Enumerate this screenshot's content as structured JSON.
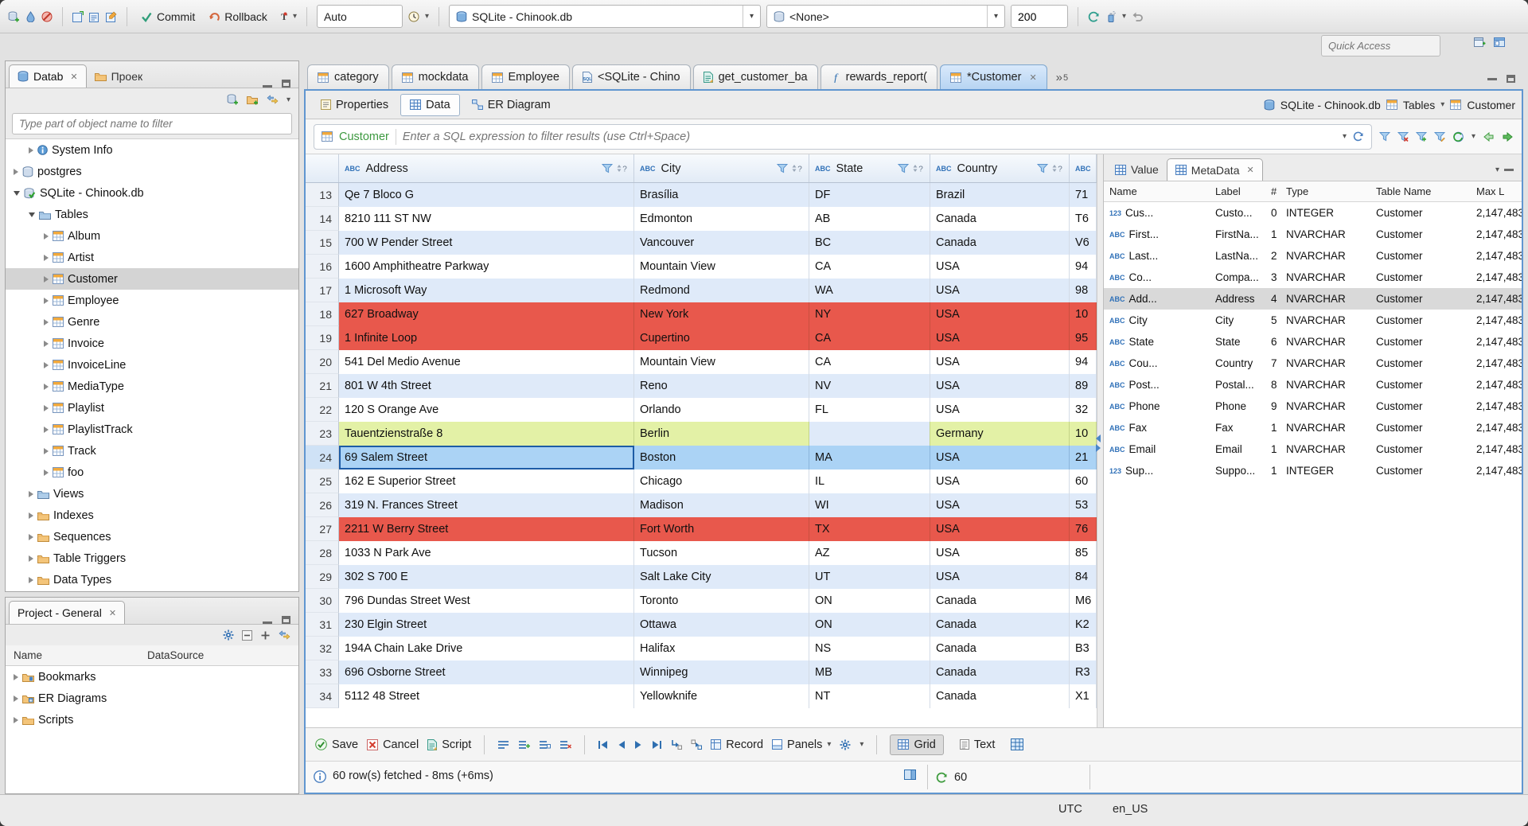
{
  "colors": {
    "row_error": "#e8584c",
    "row_match": "#e3f1a6",
    "row_selected": "#abd3f5",
    "row_alt": "#dfeaf9",
    "filter_table_green": "#3d9940"
  },
  "window": {
    "toolbar": {
      "commit": "Commit",
      "rollback": "Rollback",
      "tx_mode": "Auto",
      "connection": "SQLite - Chinook.db",
      "schema": "<None>",
      "fetch_size": "200",
      "quick_access": "Quick Access"
    },
    "statusbar": {
      "tz": "UTC",
      "locale": "en_US"
    }
  },
  "navigator": {
    "tabs": [
      {
        "label": "Datab",
        "icon": "db-blue",
        "active": true,
        "closable": true
      },
      {
        "label": "Проек",
        "icon": "folder",
        "active": false,
        "closable": false
      }
    ],
    "filter_placeholder": "Type part of object name to filter",
    "tree": [
      {
        "label": "System Info",
        "level": 1,
        "arrow": "r",
        "icon": "info"
      },
      {
        "label": "postgres",
        "level": 0,
        "arrow": "r",
        "icon": "db"
      },
      {
        "label": "SQLite - Chinook.db",
        "level": 0,
        "arrow": "d",
        "icon": "db-green"
      },
      {
        "label": "Tables",
        "level": 1,
        "arrow": "d",
        "icon": "folder-blue"
      },
      {
        "label": "Album",
        "level": 2,
        "arrow": "r",
        "icon": "table"
      },
      {
        "label": "Artist",
        "level": 2,
        "arrow": "r",
        "icon": "table"
      },
      {
        "label": "Customer",
        "level": 2,
        "arrow": "r",
        "icon": "table",
        "selected": true
      },
      {
        "label": "Employee",
        "level": 2,
        "arrow": "r",
        "icon": "table"
      },
      {
        "label": "Genre",
        "level": 2,
        "arrow": "r",
        "icon": "table"
      },
      {
        "label": "Invoice",
        "level": 2,
        "arrow": "r",
        "icon": "table"
      },
      {
        "label": "InvoiceLine",
        "level": 2,
        "arrow": "r",
        "icon": "table"
      },
      {
        "label": "MediaType",
        "level": 2,
        "arrow": "r",
        "icon": "table"
      },
      {
        "label": "Playlist",
        "level": 2,
        "arrow": "r",
        "icon": "table"
      },
      {
        "label": "PlaylistTrack",
        "level": 2,
        "arrow": "r",
        "icon": "table"
      },
      {
        "label": "Track",
        "level": 2,
        "arrow": "r",
        "icon": "table"
      },
      {
        "label": "foo",
        "level": 2,
        "arrow": "r",
        "icon": "table"
      },
      {
        "label": "Views",
        "level": 1,
        "arrow": "r",
        "icon": "folder-blue"
      },
      {
        "label": "Indexes",
        "level": 1,
        "arrow": "r",
        "icon": "folder"
      },
      {
        "label": "Sequences",
        "level": 1,
        "arrow": "r",
        "icon": "folder"
      },
      {
        "label": "Table Triggers",
        "level": 1,
        "arrow": "r",
        "icon": "folder"
      },
      {
        "label": "Data Types",
        "level": 1,
        "arrow": "r",
        "icon": "folder"
      }
    ]
  },
  "project": {
    "title": "Project - General",
    "columns": [
      "Name",
      "DataSource"
    ],
    "items": [
      {
        "label": "Bookmarks",
        "icon": "folder-bm"
      },
      {
        "label": "ER Diagrams",
        "icon": "folder-er"
      },
      {
        "label": "Scripts",
        "icon": "folder"
      }
    ]
  },
  "editor": {
    "tabs": [
      {
        "label": "category",
        "icon": "table"
      },
      {
        "label": "mockdata",
        "icon": "table"
      },
      {
        "label": "Employee",
        "icon": "table"
      },
      {
        "label": "<SQLite - Chino",
        "icon": "sqlpage"
      },
      {
        "label": "get_customer_ba",
        "icon": "script"
      },
      {
        "label": "rewards_report(",
        "icon": "func"
      },
      {
        "label": "*Customer",
        "icon": "table",
        "active": true,
        "closable": true
      }
    ],
    "overflow": "5",
    "subtabs": [
      {
        "label": "Properties",
        "icon": "props"
      },
      {
        "label": "Data",
        "icon": "grid-blue",
        "active": true
      },
      {
        "label": "ER Diagram",
        "icon": "er"
      }
    ],
    "context": {
      "connection": "SQLite - Chinook.db",
      "container": "Tables",
      "object": "Customer"
    }
  },
  "filter": {
    "table": "Customer",
    "placeholder": "Enter a SQL expression to filter results (use Ctrl+Space)"
  },
  "grid": {
    "columns": [
      "Address",
      "City",
      "State",
      "Country",
      ""
    ],
    "rows": [
      {
        "num": "13",
        "bg": "alt",
        "cells": [
          "Qe 7 Bloco G",
          "Brasília",
          "DF",
          "Brazil",
          "71"
        ]
      },
      {
        "num": "14",
        "bg": "plain",
        "cells": [
          "8210 111 ST NW",
          "Edmonton",
          "AB",
          "Canada",
          "T6"
        ]
      },
      {
        "num": "15",
        "bg": "alt",
        "cells": [
          "700 W Pender Street",
          "Vancouver",
          "BC",
          "Canada",
          "V6"
        ]
      },
      {
        "num": "16",
        "bg": "plain",
        "cells": [
          "1600 Amphitheatre Parkway",
          "Mountain View",
          "CA",
          "USA",
          "94"
        ]
      },
      {
        "num": "17",
        "bg": "alt",
        "cells": [
          "1 Microsoft Way",
          "Redmond",
          "WA",
          "USA",
          "98"
        ]
      },
      {
        "num": "18",
        "bg": "red",
        "cells": [
          "627 Broadway",
          "New York",
          "NY",
          "USA",
          "10"
        ]
      },
      {
        "num": "19",
        "bg": "red",
        "cells": [
          "1 Infinite Loop",
          "Cupertino",
          "CA",
          "USA",
          "95"
        ]
      },
      {
        "num": "20",
        "bg": "plain",
        "cells": [
          "541 Del Medio Avenue",
          "Mountain View",
          "CA",
          "USA",
          "94"
        ]
      },
      {
        "num": "21",
        "bg": "alt",
        "cells": [
          "801 W 4th Street",
          "Reno",
          "NV",
          "USA",
          "89"
        ]
      },
      {
        "num": "22",
        "bg": "plain",
        "cells": [
          "120 S Orange Ave",
          "Orlando",
          "FL",
          "USA",
          "32"
        ]
      },
      {
        "num": "23",
        "bg": "green",
        "cells": [
          "Tauentzienstraße 8",
          "Berlin",
          "",
          "Germany",
          "10"
        ],
        "cell_alt": [
          2
        ]
      },
      {
        "num": "24",
        "bg": "sel",
        "cells": [
          "69 Salem Street",
          "Boston",
          "MA",
          "USA",
          "21"
        ],
        "focus_cell": 0
      },
      {
        "num": "25",
        "bg": "plain",
        "cells": [
          "162 E Superior Street",
          "Chicago",
          "IL",
          "USA",
          "60"
        ]
      },
      {
        "num": "26",
        "bg": "alt",
        "cells": [
          "319 N. Frances Street",
          "Madison",
          "WI",
          "USA",
          "53"
        ]
      },
      {
        "num": "27",
        "bg": "red",
        "cells": [
          "2211 W Berry Street",
          "Fort Worth",
          "TX",
          "USA",
          "76"
        ]
      },
      {
        "num": "28",
        "bg": "plain",
        "cells": [
          "1033 N Park Ave",
          "Tucson",
          "AZ",
          "USA",
          "85"
        ]
      },
      {
        "num": "29",
        "bg": "alt",
        "cells": [
          "302 S 700 E",
          "Salt Lake City",
          "UT",
          "USA",
          "84"
        ]
      },
      {
        "num": "30",
        "bg": "plain",
        "cells": [
          "796 Dundas Street West",
          "Toronto",
          "ON",
          "Canada",
          "M6"
        ]
      },
      {
        "num": "31",
        "bg": "alt",
        "cells": [
          "230 Elgin Street",
          "Ottawa",
          "ON",
          "Canada",
          "K2"
        ]
      },
      {
        "num": "32",
        "bg": "plain",
        "cells": [
          "194A Chain Lake Drive",
          "Halifax",
          "NS",
          "Canada",
          "B3"
        ]
      },
      {
        "num": "33",
        "bg": "alt",
        "cells": [
          "696 Osborne Street",
          "Winnipeg",
          "MB",
          "Canada",
          "R3"
        ]
      },
      {
        "num": "34",
        "bg": "plain",
        "cells": [
          "5112 48 Street",
          "Yellowknife",
          "NT",
          "Canada",
          "X1"
        ]
      }
    ]
  },
  "panel": {
    "tabs": [
      {
        "label": "Value",
        "icon": "grid-blue",
        "active": false,
        "closable": false
      },
      {
        "label": "MetaData",
        "icon": "grid-blue",
        "active": true,
        "closable": true
      }
    ],
    "columns": [
      "Name",
      "Label",
      "#",
      "Type",
      "Table Name",
      "Max L"
    ],
    "rows": [
      {
        "icon": "n123",
        "name": "Cus...",
        "label": "Custo...",
        "num": "0",
        "type": "INTEGER",
        "table": "Customer",
        "max": "2,147,483"
      },
      {
        "icon": "abc",
        "name": "First...",
        "label": "FirstNa...",
        "num": "1",
        "type": "NVARCHAR",
        "table": "Customer",
        "max": "2,147,483"
      },
      {
        "icon": "abc",
        "name": "Last...",
        "label": "LastNa...",
        "num": "2",
        "type": "NVARCHAR",
        "table": "Customer",
        "max": "2,147,483"
      },
      {
        "icon": "abc",
        "name": "Co...",
        "label": "Compa...",
        "num": "3",
        "type": "NVARCHAR",
        "table": "Customer",
        "max": "2,147,483"
      },
      {
        "icon": "abc",
        "name": "Add...",
        "label": "Address",
        "num": "4",
        "type": "NVARCHAR",
        "table": "Customer",
        "max": "2,147,483",
        "selected": true
      },
      {
        "icon": "abc",
        "name": "City",
        "label": "City",
        "num": "5",
        "type": "NVARCHAR",
        "table": "Customer",
        "max": "2,147,483"
      },
      {
        "icon": "abc",
        "name": "State",
        "label": "State",
        "num": "6",
        "type": "NVARCHAR",
        "table": "Customer",
        "max": "2,147,483"
      },
      {
        "icon": "abc",
        "name": "Cou...",
        "label": "Country",
        "num": "7",
        "type": "NVARCHAR",
        "table": "Customer",
        "max": "2,147,483"
      },
      {
        "icon": "abc",
        "name": "Post...",
        "label": "Postal...",
        "num": "8",
        "type": "NVARCHAR",
        "table": "Customer",
        "max": "2,147,483"
      },
      {
        "icon": "abc",
        "name": "Phone",
        "label": "Phone",
        "num": "9",
        "type": "NVARCHAR",
        "table": "Customer",
        "max": "2,147,483"
      },
      {
        "icon": "abc",
        "name": "Fax",
        "label": "Fax",
        "num": "1",
        "type": "NVARCHAR",
        "table": "Customer",
        "max": "2,147,483"
      },
      {
        "icon": "abc",
        "name": "Email",
        "label": "Email",
        "num": "1",
        "type": "NVARCHAR",
        "table": "Customer",
        "max": "2,147,483"
      },
      {
        "icon": "n123",
        "name": "Sup...",
        "label": "Suppo...",
        "num": "1",
        "type": "INTEGER",
        "table": "Customer",
        "max": "2,147,483"
      }
    ]
  },
  "result_toolbar": {
    "save": "Save",
    "cancel": "Cancel",
    "script": "Script",
    "record": "Record",
    "panels": "Panels",
    "grid": "Grid",
    "text": "Text"
  },
  "status": {
    "fetched": "60 row(s) fetched - 8ms (+6ms)",
    "auto_refresh": "60"
  }
}
